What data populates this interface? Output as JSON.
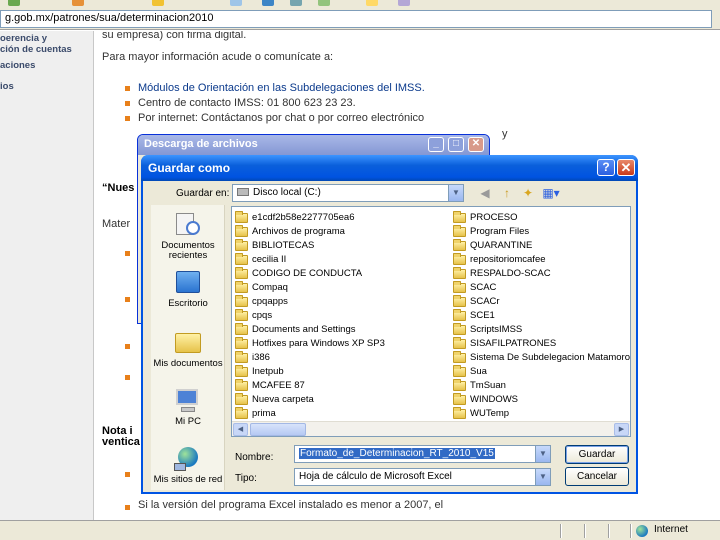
{
  "browser": {
    "address": "g.gob.mx/patrones/sua/determinacion2010"
  },
  "left_nav": {
    "items": [
      "oerencia y",
      "ción de cuentas",
      "aciones",
      "ios"
    ]
  },
  "page": {
    "line_top": "su empresa) con firma digital.",
    "more_info": "Para mayor información acude o comunícate a:",
    "bullets": [
      "Módulos de Orientación en las Subdelegaciones del IMSS.",
      "Centro de contacto IMSS: 01 800 623 23 23.",
      "Por internet: Contáctanos por chat o por correo electrónico"
    ],
    "bullet_tail": "y",
    "quote_start": "“Nues",
    "mater": "Mater",
    "note_start": "Nota i",
    "note_start2": "ventica",
    "last_bullet": "Si la versión del programa Excel instalado es menor a 2007, el"
  },
  "status_bar": {
    "zone": "Internet"
  },
  "download_dialog": {
    "title": "Descarga de archivos"
  },
  "save_dialog": {
    "title": "Guardar como",
    "help_label": "?",
    "close_label": "✕",
    "save_in_label": "Guardar en:",
    "save_in_value": "Disco local (C:)",
    "places": [
      {
        "label": "Documentos recientes",
        "icon": "recent-documents-icon"
      },
      {
        "label": "Escritorio",
        "icon": "desktop-icon"
      },
      {
        "label": "Mis documentos",
        "icon": "my-documents-icon"
      },
      {
        "label": "Mi PC",
        "icon": "my-computer-icon"
      },
      {
        "label": "Mis sitios de red",
        "icon": "network-places-icon"
      }
    ],
    "folders_col1": [
      "e1cdf2b58e2277705ea6",
      "Archivos de programa",
      "BIBLIOTECAS",
      "cecilia II",
      "CODIGO DE CONDUCTA",
      "Compaq",
      "cpqapps",
      "cpqs",
      "Documents and Settings",
      "Hotfixes  para   Windows  XP  SP3",
      "i386",
      "Inetpub",
      "MCAFEE 87",
      "Nueva carpeta",
      "prima"
    ],
    "folders_col2": [
      "PROCESO",
      "Program Files",
      "QUARANTINE",
      "repositoriomcafee",
      "RESPALDO-SCAC",
      "SCAC",
      "SCACr",
      "SCE1",
      "ScriptsIMSS",
      "SISAFILPATRONES",
      "Sistema De Subdelegacion Matamoros",
      "Sua",
      "TmSuan",
      "WINDOWS",
      "WUTemp"
    ],
    "filename_label": "Nombre:",
    "filename_value": "Formato_de_Determinacion_RT_2010_V15",
    "type_label": "Tipo:",
    "type_value": "Hoja de cálculo de Microsoft Excel",
    "save_button": "Guardar",
    "cancel_button": "Cancelar"
  }
}
